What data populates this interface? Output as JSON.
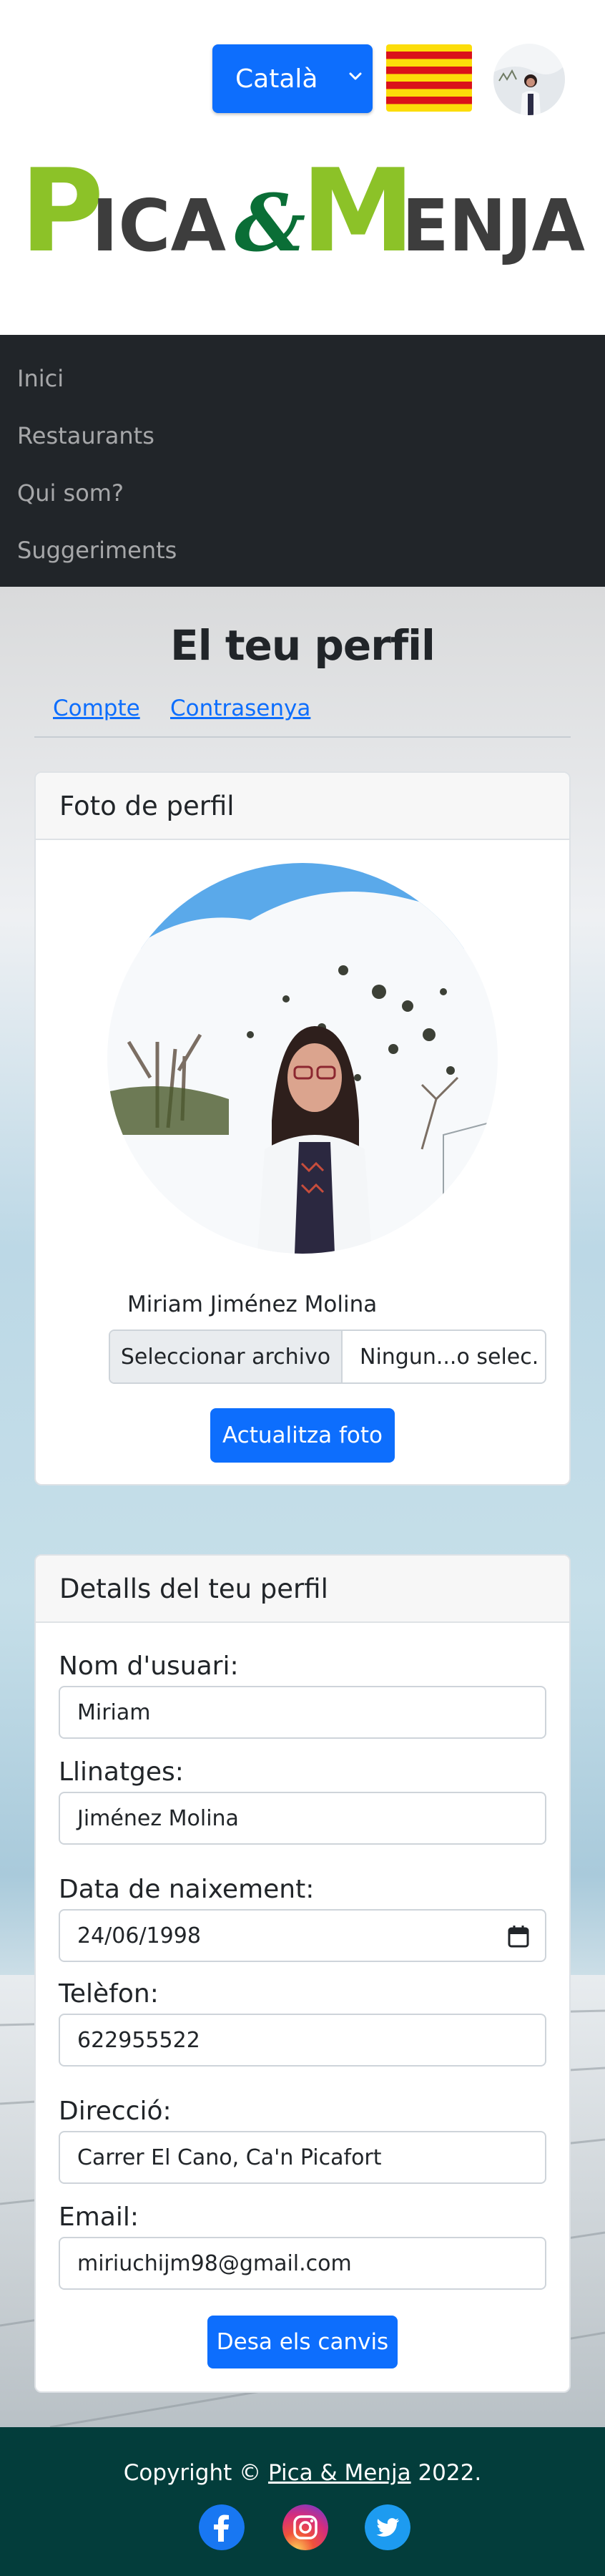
{
  "header": {
    "language_select": {
      "selected": "Català"
    },
    "logo_text": "Pica & Menja"
  },
  "nav": {
    "items": [
      {
        "label": "Inici"
      },
      {
        "label": "Restaurants"
      },
      {
        "label": "Qui som?"
      },
      {
        "label": "Suggeriments"
      }
    ]
  },
  "profile": {
    "title": "El teu perfil",
    "tabs": [
      {
        "label": "Compte"
      },
      {
        "label": "Contrasenya"
      }
    ],
    "photo_card": {
      "header": "Foto de perfil",
      "name": "Miriam Jiménez Molina",
      "file_button": "Seleccionar archivo",
      "file_status": "Ningun...o selec.",
      "submit": "Actualitza foto"
    },
    "details_card": {
      "header": "Detalls del teu perfil",
      "fields": [
        {
          "label": "Nom d'usuari:",
          "value": "Miriam"
        },
        {
          "label": "Llinatges:",
          "value": "Jiménez Molina"
        },
        {
          "label": "Data de naixement:",
          "value": "24/06/1998"
        },
        {
          "label": "Telèfon:",
          "value": "622955522"
        },
        {
          "label": "Direcció:",
          "value": "Carrer El Cano, Ca'n Picafort"
        },
        {
          "label": "Email:",
          "value": "miriuchijm98@gmail.com"
        }
      ],
      "submit": "Desa els canvis"
    }
  },
  "footer": {
    "copyright_prefix": "Copyright © ",
    "brand": "Pica & Menja",
    "year_suffix": " 2022.",
    "social": [
      "facebook-icon",
      "instagram-icon",
      "twitter-icon"
    ]
  },
  "colors": {
    "primary": "#0d6efd",
    "nav_bg": "#212529",
    "footer_bg": "#033d3b",
    "logo_green_light": "#8cc228",
    "logo_green_dark": "#0a6e36",
    "logo_gray": "#3d3d3d"
  }
}
